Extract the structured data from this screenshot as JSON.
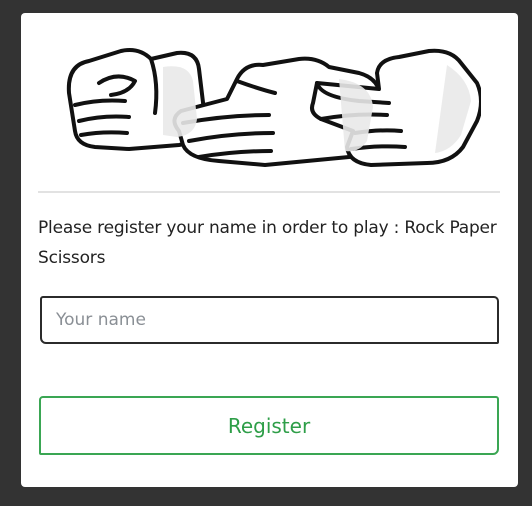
{
  "hero": {
    "icon": "rock-paper-scissors-hands-icon"
  },
  "register_form": {
    "instruction": "Please register your name in order to play : Rock Paper Scissors",
    "name_placeholder": "Your name",
    "name_value": "",
    "register_label": "Register"
  },
  "colors": {
    "background": "#333333",
    "card": "#ffffff",
    "accent_green": "#3aa653",
    "input_border": "#2b2b2b"
  }
}
